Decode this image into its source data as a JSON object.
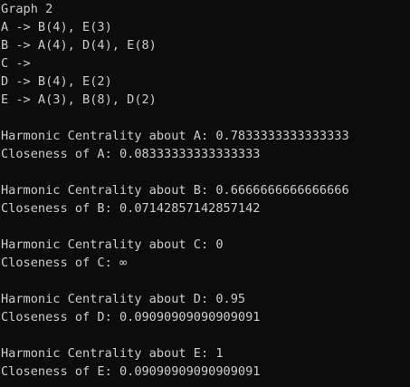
{
  "console": {
    "lines": [
      "Graph 2",
      "A -> B(4), E(3)",
      "B -> A(4), D(4), E(8)",
      "C ->",
      "D -> B(4), E(2)",
      "E -> A(3), B(8), D(2)",
      "",
      "Harmonic Centrality about A: 0.7833333333333333",
      "Closeness of A: 0.08333333333333333",
      "",
      "Harmonic Centrality about B: 0.6666666666666666",
      "Closeness of B: 0.07142857142857142",
      "",
      "Harmonic Centrality about C: 0",
      "Closeness of C: ∞",
      "",
      "Harmonic Centrality about D: 0.95",
      "Closeness of D: 0.09090909090909091",
      "",
      "Harmonic Centrality about E: 1",
      "Closeness of E: 0.09090909090909091"
    ]
  }
}
